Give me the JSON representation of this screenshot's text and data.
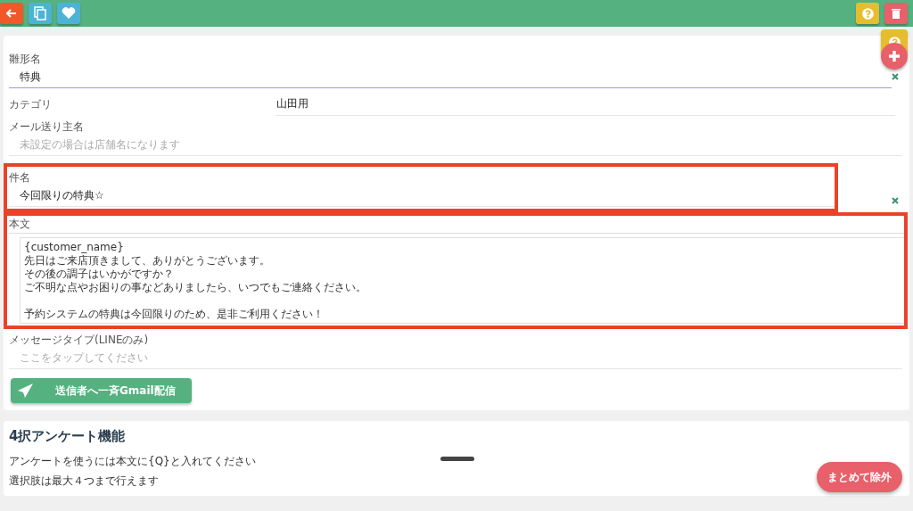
{
  "toolbar": {
    "left_buttons": [
      {
        "kind": "back"
      },
      {
        "kind": "copy"
      },
      {
        "kind": "favorite"
      }
    ],
    "right_buttons": [
      {
        "kind": "help"
      },
      {
        "kind": "delete"
      }
    ]
  },
  "form": {
    "fields": [
      {
        "kind": "text",
        "label": "雛形名",
        "value": "特典",
        "clearable": true,
        "focused": true
      },
      {
        "kind": "inline",
        "label": "カテゴリ",
        "value": "山田用"
      },
      {
        "kind": "text",
        "label": "メール送り主名",
        "placeholder": "未設定の場合は店舗名になります"
      },
      {
        "kind": "text",
        "label": "件名",
        "value": "今回限りの特典☆",
        "clearable": true,
        "highlighted": true
      },
      {
        "kind": "textarea",
        "label": "本文",
        "paragraphs": [
          [
            "{customer_name}",
            "先日はご来店頂きまして、ありがとうございます。",
            "その後の調子はいかがですか？",
            "ご不明な点やお困りの事などありましたら、いつでもご連絡ください。"
          ],
          [
            "予約システムの特典は今回限りのため、是非ご利用ください！"
          ]
        ],
        "highlighted": true
      },
      {
        "kind": "text",
        "label": "メッセージタイプ(LINEのみ)",
        "placeholder": "ここをタップしてください"
      }
    ],
    "send_button": "送信者へ一斉Gmail配信"
  },
  "survey": {
    "title": "4択アンケート機能",
    "notes": [
      "アンケートを使うには本文に{Q}と入れてください",
      "選択肢は最大４つまで行えます"
    ]
  },
  "floating": {
    "exclude_button": "まとめて除外"
  }
}
